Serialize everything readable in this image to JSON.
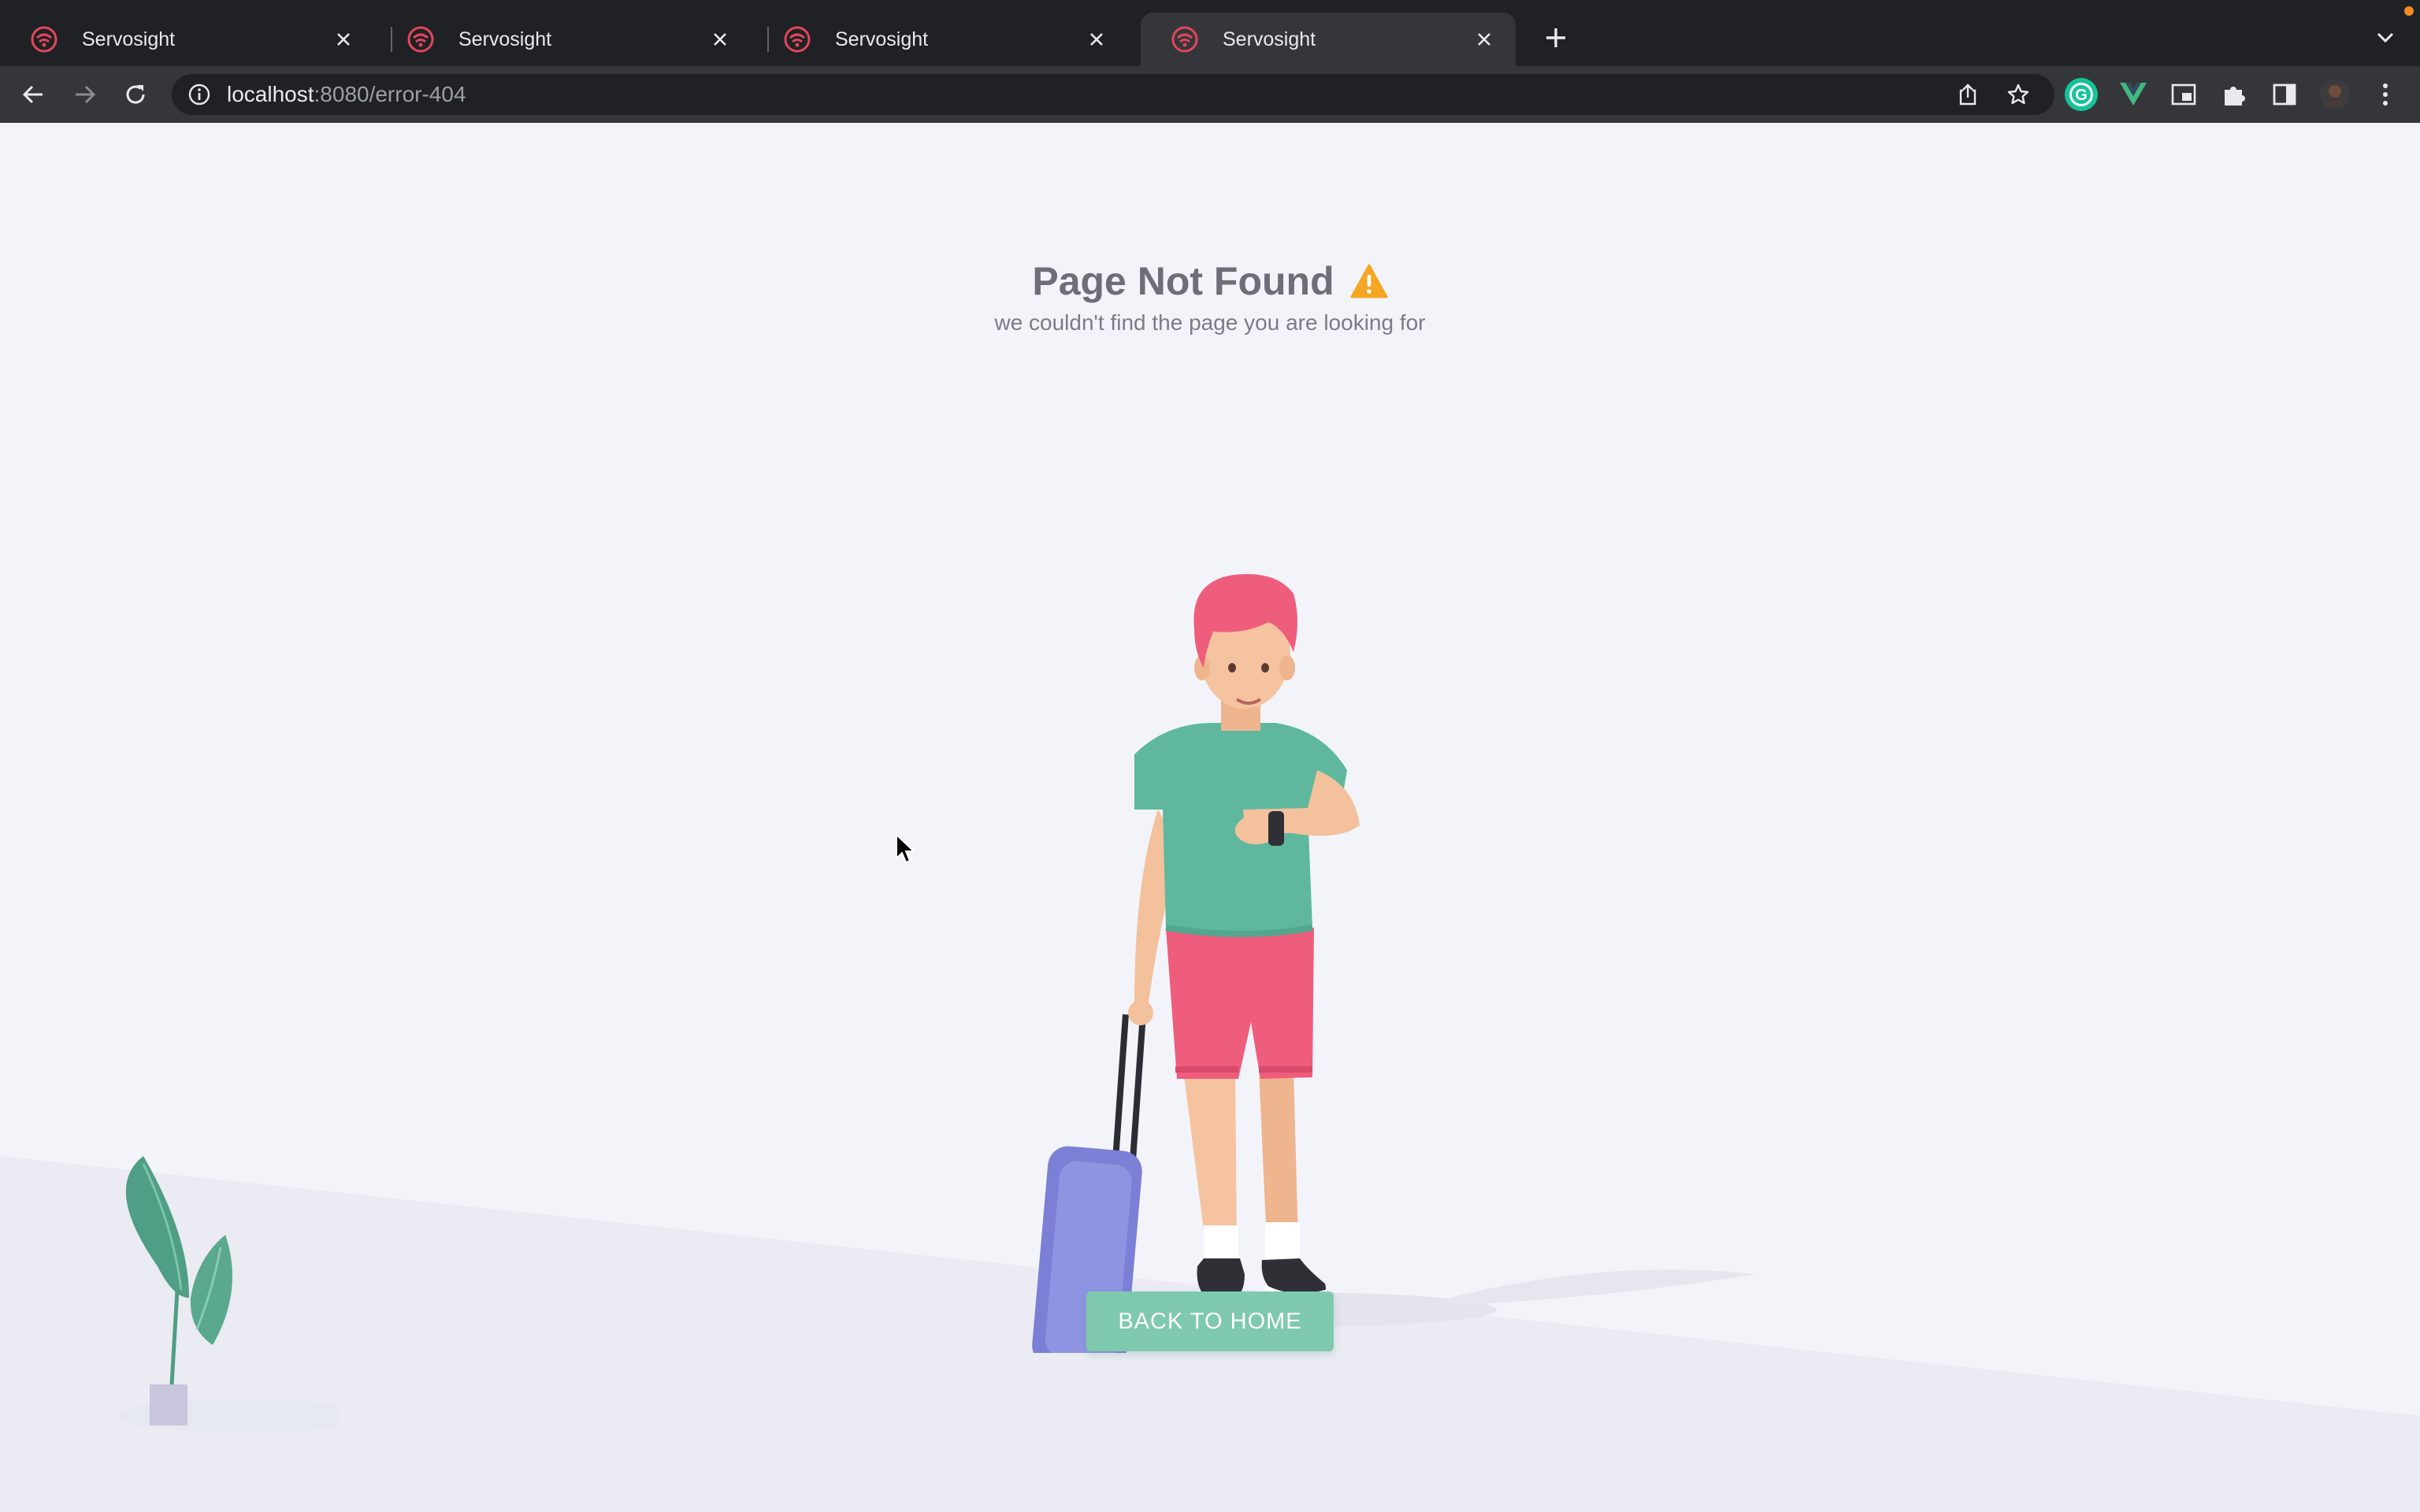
{
  "browser": {
    "tabs": [
      {
        "title": "Servosight",
        "active": false
      },
      {
        "title": "Servosight",
        "active": false
      },
      {
        "title": "Servosight",
        "active": false
      },
      {
        "title": "Servosight",
        "active": true
      }
    ],
    "url_host": "localhost",
    "url_path": ":8080/error-404",
    "icons": {
      "back": "arrow-left-icon",
      "forward": "arrow-right-icon",
      "reload": "reload-icon",
      "site_info": "info-circle-icon",
      "share": "share-icon",
      "bookmark": "star-icon",
      "extensions": [
        "grammarly-icon",
        "vue-devtools-icon",
        "picture-in-picture-icon",
        "puzzle-icon",
        "side-panel-icon",
        "profile-avatar-icon"
      ],
      "menu": "kebab-menu-icon"
    }
  },
  "page": {
    "title": "Page Not Found",
    "subtitle": "we couldn't find the page you are looking for",
    "button_label": "BACK TO HOME",
    "colors": {
      "background": "#f3f4fa",
      "button": "#7fc9ae",
      "warning": "#f5a623",
      "favicon": "#e0475b"
    }
  }
}
